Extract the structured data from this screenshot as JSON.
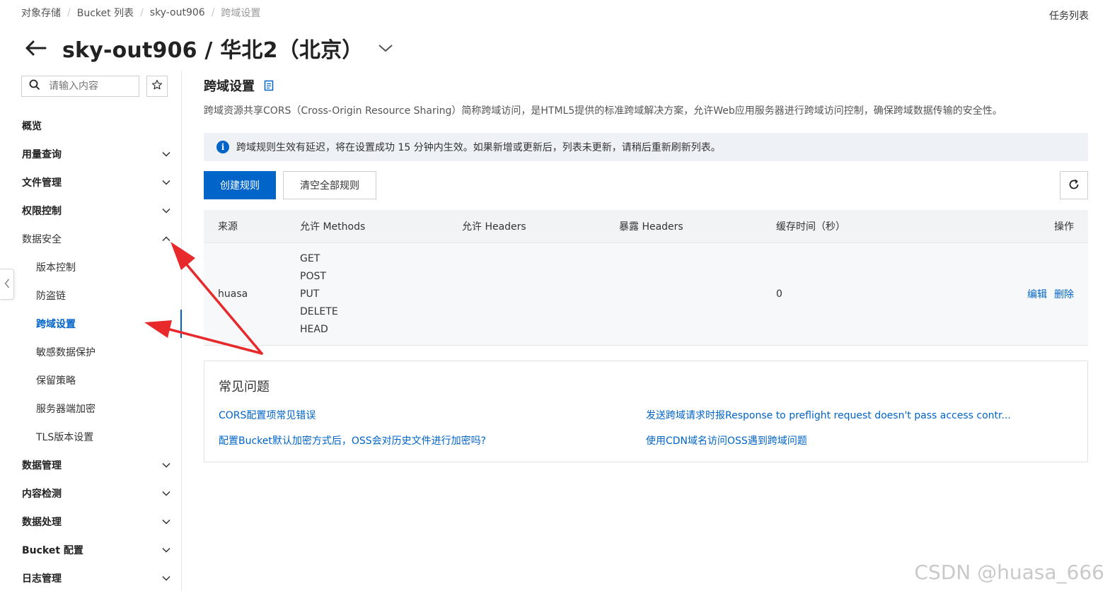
{
  "breadcrumb": {
    "items": [
      "对象存储",
      "Bucket 列表",
      "sky-out906"
    ],
    "current": "跨域设置"
  },
  "task_list_label": "任务列表",
  "header": {
    "title": "sky-out906 / 华北2（北京）"
  },
  "sidebar": {
    "search_placeholder": "请输入内容",
    "nav": [
      {
        "label": "概览",
        "expandable": false
      },
      {
        "label": "用量查询",
        "expandable": true
      },
      {
        "label": "文件管理",
        "expandable": true
      },
      {
        "label": "权限控制",
        "expandable": true
      },
      {
        "label": "数据安全",
        "expandable": true,
        "expanded": true
      },
      {
        "label": "数据管理",
        "expandable": true
      },
      {
        "label": "内容检测",
        "expandable": true
      },
      {
        "label": "数据处理",
        "expandable": true
      },
      {
        "label": "Bucket 配置",
        "expandable": true
      },
      {
        "label": "日志管理",
        "expandable": true
      }
    ],
    "data_security_sub": [
      "版本控制",
      "防盗链",
      "跨域设置",
      "敏感数据保护",
      "保留策略",
      "服务器端加密",
      "TLS版本设置"
    ],
    "active_sub": "跨域设置"
  },
  "main": {
    "section_title": "跨域设置",
    "description": "跨域资源共享CORS（Cross-Origin Resource Sharing）简称跨域访问，是HTML5提供的标准跨域解决方案，允许Web应用服务器进行跨域访问控制，确保跨域数据传输的安全性。",
    "notice": "跨域规则生效有延迟，将在设置成功 15 分钟内生效。如果新增或更新后，列表未更新，请稍后重新刷新列表。",
    "create_button": "创建规则",
    "clear_button": "清空全部规则",
    "table": {
      "headers": [
        "来源",
        "允许 Methods",
        "允许 Headers",
        "暴露 Headers",
        "缓存时间（秒）",
        "操作"
      ],
      "rows": [
        {
          "source": "huasa",
          "methods": [
            "GET",
            "POST",
            "PUT",
            "DELETE",
            "HEAD"
          ],
          "allow_headers": "",
          "expose_headers": "",
          "cache_seconds": "0",
          "actions": [
            "编辑",
            "删除"
          ]
        }
      ]
    },
    "faq": {
      "title": "常见问题",
      "links": [
        "CORS配置项常见错误",
        "发送跨域请求时报Response to preflight request doesn't pass access contr...",
        "配置Bucket默认加密方式后，OSS会对历史文件进行加密吗?",
        "使用CDN域名访问OSS遇到跨域问题"
      ]
    }
  },
  "watermark": "CSDN @huasa_666",
  "colors": {
    "accent": "#0064c8",
    "annotation_arrow": "#e8292b"
  }
}
